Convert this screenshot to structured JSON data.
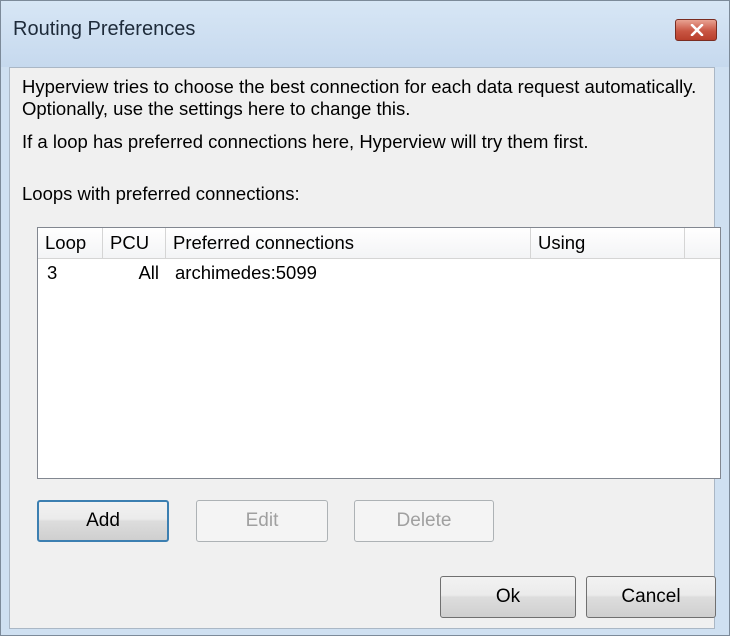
{
  "window": {
    "title": "Routing Preferences",
    "close_icon": "close-x-icon"
  },
  "description": {
    "line1": "Hyperview tries to choose the best connection for each data request automatically.  Optionally, use the settings here to change this.",
    "line2": "If a loop has preferred connections here, Hyperview will try them first.",
    "list_label": "Loops with preferred connections:"
  },
  "table": {
    "columns": [
      "Loop",
      "PCU",
      "Preferred connections",
      "Using"
    ],
    "rows": [
      {
        "loop": "3",
        "pcu": "All",
        "preferred": "archimedes:5099",
        "using": ""
      }
    ]
  },
  "buttons": {
    "add": "Add",
    "edit": "Edit",
    "delete": "Delete",
    "ok": "Ok",
    "cancel": "Cancel"
  },
  "colors": {
    "titlebar": "#c6d9ee",
    "close_button": "#c95643",
    "dialog_background": "#f0f0f0"
  }
}
